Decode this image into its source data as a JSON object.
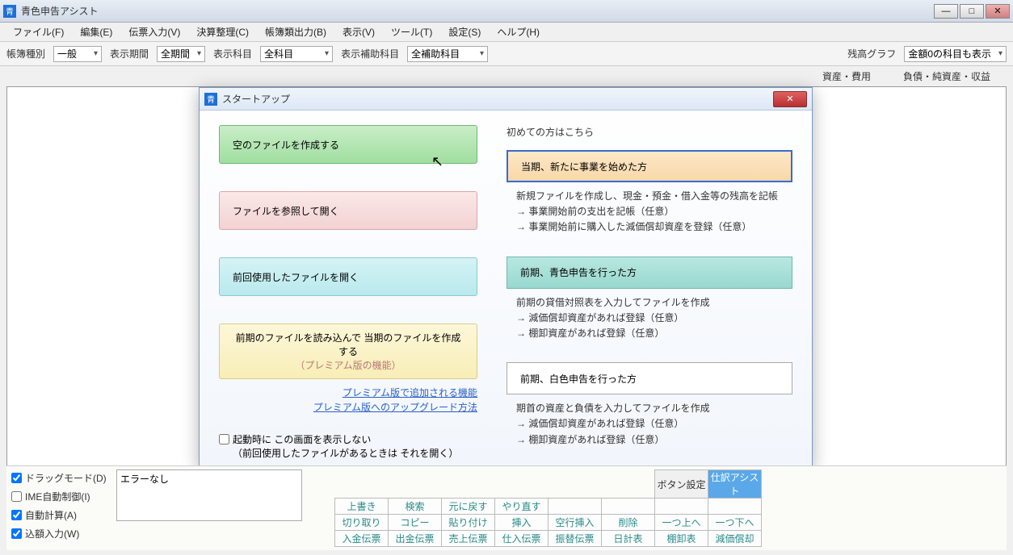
{
  "window": {
    "title": "青色申告アシスト",
    "icon_text": "青"
  },
  "menubar": [
    "ファイル(F)",
    "編集(E)",
    "伝票入力(V)",
    "決算整理(C)",
    "帳簿類出力(B)",
    "表示(V)",
    "ツール(T)",
    "設定(S)",
    "ヘルプ(H)"
  ],
  "filters": {
    "ledger_label": "帳簿種別",
    "ledger_value": "一般",
    "period_label": "表示期間",
    "period_value": "全期間",
    "subject_label": "表示科目",
    "subject_value": "全科目",
    "aux_label": "表示補助科目",
    "aux_value": "全補助科目",
    "balance_label": "残高グラフ",
    "balance_value": "金額0の科目も表示"
  },
  "second_row": {
    "left": "資産・費用",
    "right": "負債・純資産・収益"
  },
  "dialog": {
    "title": "スタートアップ",
    "icon_text": "青",
    "left": {
      "btn_green": "空のファイルを作成する",
      "btn_pink": "ファイルを参照して開く",
      "btn_cyan": "前回使用したファイルを開く",
      "btn_yellow_l1": "前期のファイルを読み込んで 当期のファイルを作成する",
      "btn_yellow_l2": "（プレミアム版の機能）",
      "link1": "プレミアム版で追加される機能",
      "link2": "プレミアム版へのアップグレード方法",
      "chk_label": "起動時に この画面を表示しない",
      "chk_sub": "（前回使用したファイルがあるときは それを開く）"
    },
    "right": {
      "heading": "初めての方はこちら",
      "btn_orange": "当期、新たに事業を始めた方",
      "desc_orange_l1": "新規ファイルを作成し、現金・預金・借入金等の残高を記帳",
      "desc_orange_l2": "事業開始前の支出を記帳（任意）",
      "desc_orange_l3": "事業開始前に購入した減価償却資産を登録（任意）",
      "btn_teal": "前期、青色申告を行った方",
      "desc_teal_l1": "前期の貸借対照表を入力してファイルを作成",
      "desc_teal_l2": "減価償却資産があれば登録（任意）",
      "desc_teal_l3": "棚卸資産があれば登録（任意）",
      "btn_white": "前期、白色申告を行った方",
      "desc_white_l1": "期首の資産と負債を入力してファイルを作成",
      "desc_white_l2": "減価償却資産があれば登録（任意）",
      "desc_white_l3": "棚卸資産があれば登録（任意）"
    }
  },
  "bottom": {
    "chk1": "ドラッグモード(D)",
    "chk2": "IME自動制御(I)",
    "chk3": "自動計算(A)",
    "chk4": "込額入力(W)",
    "errtext": "エラーなし",
    "head1": "ボタン設定",
    "head2_hl": "仕訳アシスト",
    "grid": [
      [
        "上書き",
        "検索",
        "元に戻す",
        "やり直す",
        "",
        "",
        "",
        ""
      ],
      [
        "切り取り",
        "コピー",
        "貼り付け",
        "挿入",
        "空行挿入",
        "削除",
        "一つ上へ",
        "一つ下へ"
      ],
      [
        "入金伝票",
        "出金伝票",
        "売上伝票",
        "仕入伝票",
        "振替伝票",
        "日計表",
        "棚卸表",
        "減価償却"
      ]
    ]
  }
}
